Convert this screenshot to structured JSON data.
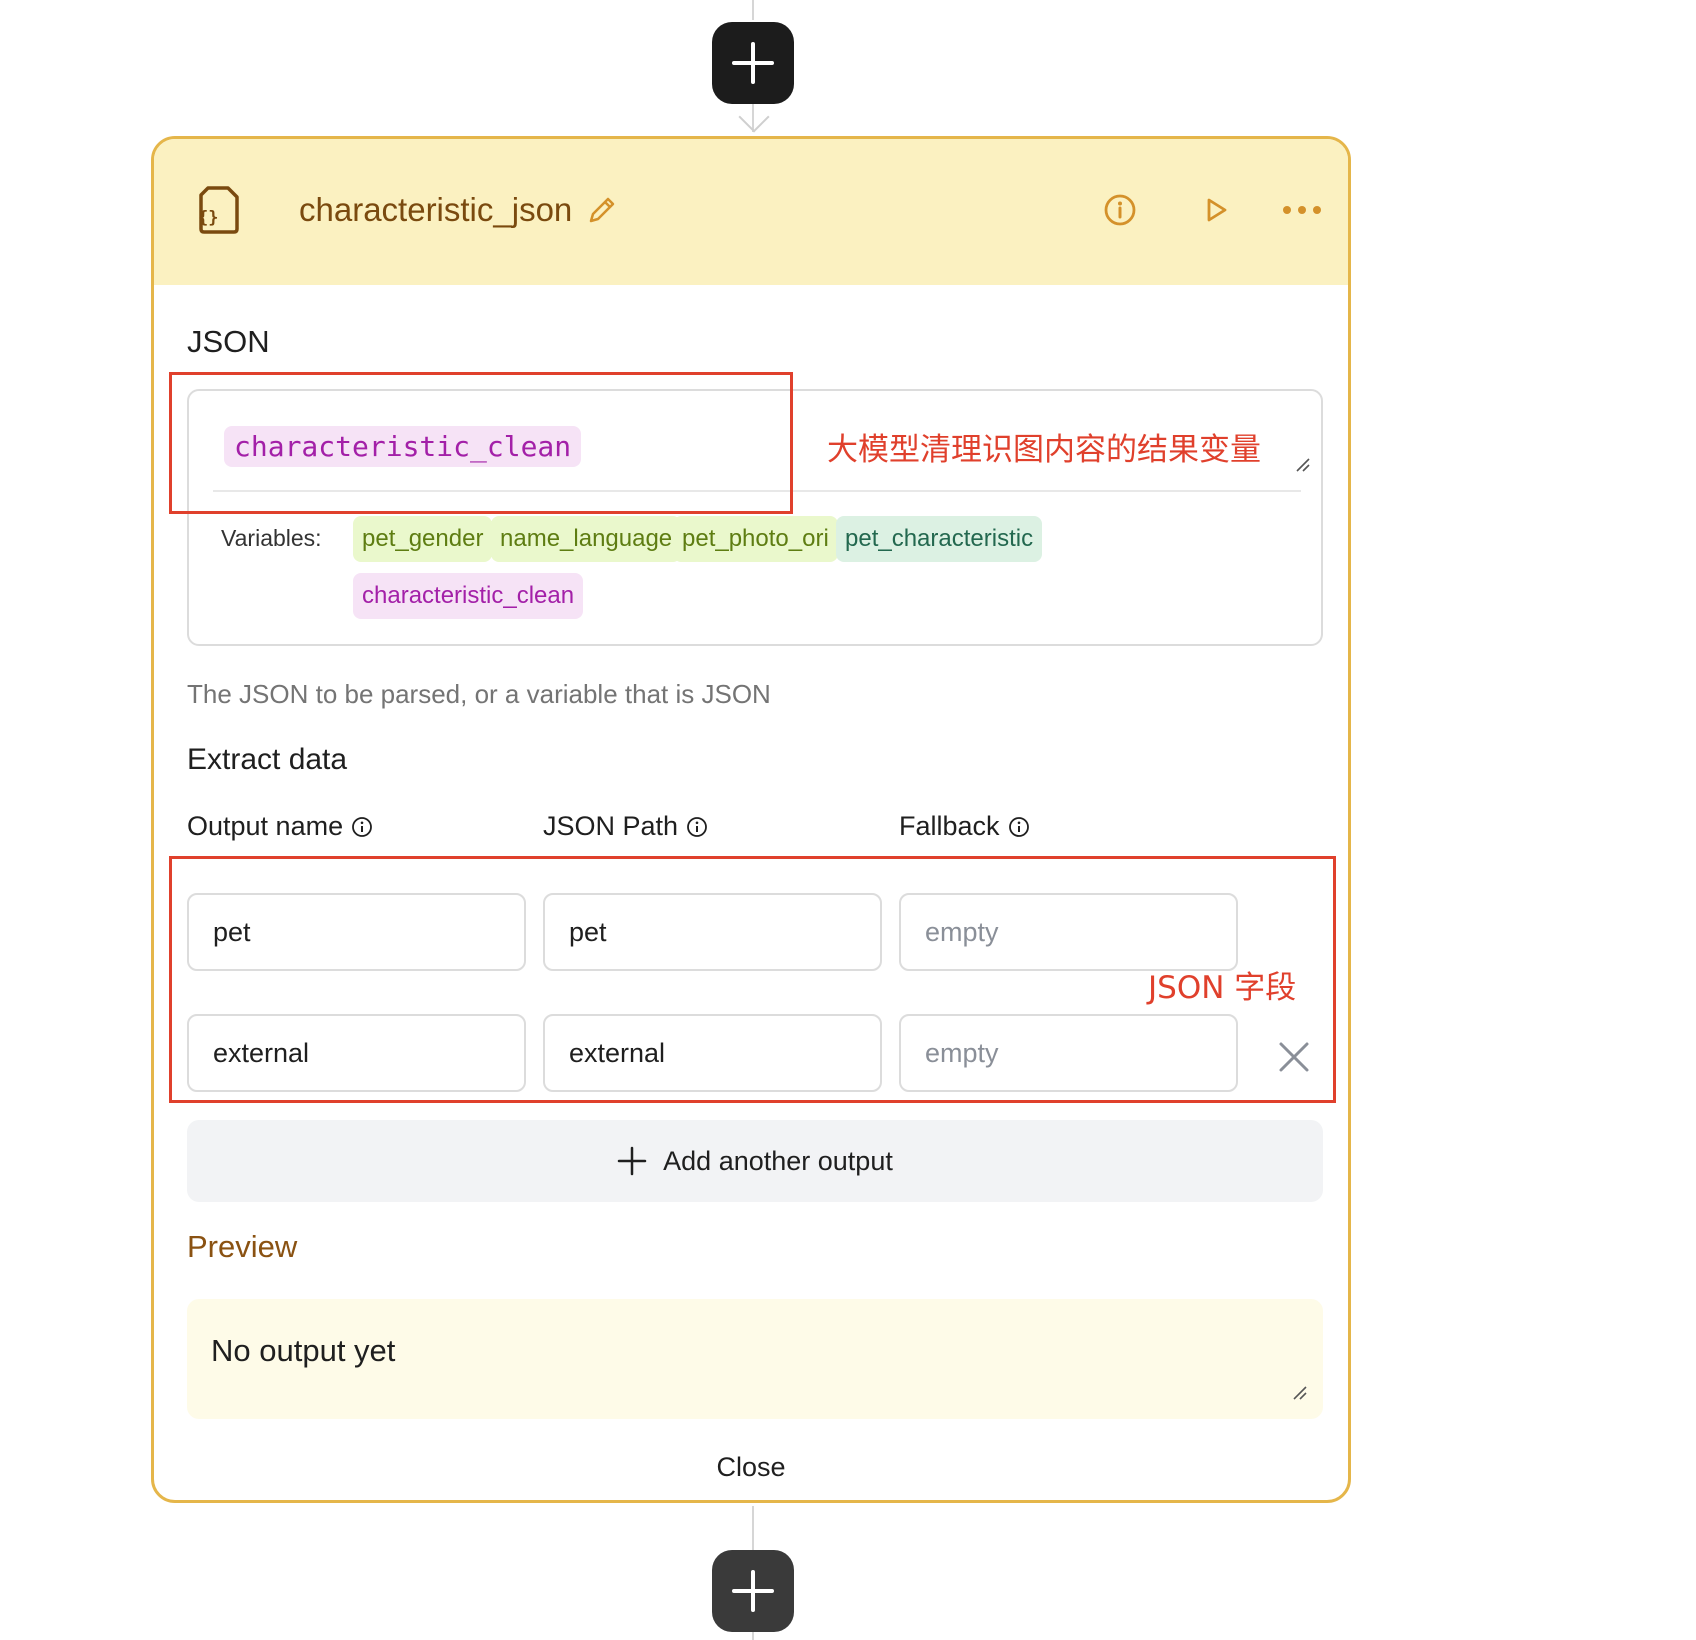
{
  "node": {
    "title": "characteristic_json"
  },
  "json_section": {
    "label": "JSON",
    "value_token": "characteristic_clean",
    "variables_label": "Variables:",
    "variables": [
      "pet_gender",
      "name_language",
      "pet_photo_ori",
      "pet_characteristic",
      "characteristic_clean"
    ],
    "hint": "The JSON to be parsed, or a variable that is JSON"
  },
  "extract": {
    "label": "Extract data",
    "columns": [
      "Output name",
      "JSON Path",
      "Fallback"
    ],
    "rows": [
      {
        "output_name": "pet",
        "json_path": "pet",
        "fallback_placeholder": "empty"
      },
      {
        "output_name": "external",
        "json_path": "external",
        "fallback_placeholder": "empty"
      }
    ],
    "add_label": "Add another output"
  },
  "preview": {
    "label": "Preview",
    "text": "No output yet"
  },
  "close_label": "Close",
  "annotations": {
    "json_note": "大模型清理识图内容的结果变量",
    "fields_note": "JSON 字段"
  },
  "colors": {
    "card_border": "#e5b64a",
    "header_bg": "#fbf1c1",
    "accent_brown": "#7a4a0f",
    "header_icon": "#d4912a",
    "annotation_red": "#e0402c"
  }
}
